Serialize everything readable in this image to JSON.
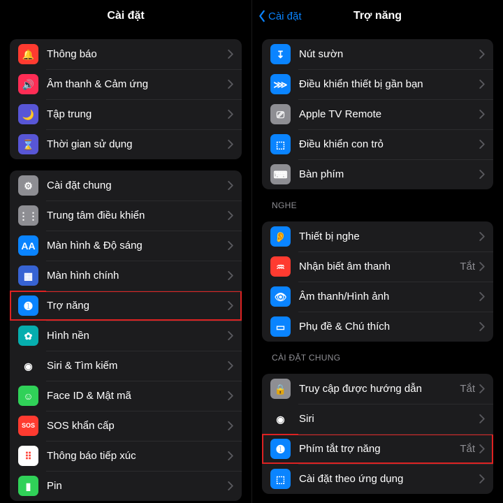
{
  "left": {
    "title": "Cài đặt",
    "groups": [
      {
        "rows": [
          {
            "key": "notifications",
            "label": "Thông báo",
            "iconBg": "#ff3b30",
            "glyph": "🔔"
          },
          {
            "key": "sounds",
            "label": "Âm thanh & Cảm ứng",
            "iconBg": "#ff2d55",
            "glyph": "🔊"
          },
          {
            "key": "focus",
            "label": "Tập trung",
            "iconBg": "#5856d6",
            "glyph": "🌙"
          },
          {
            "key": "screentime",
            "label": "Thời gian sử dụng",
            "iconBg": "#5856d6",
            "glyph": "⌛"
          }
        ]
      },
      {
        "rows": [
          {
            "key": "general",
            "label": "Cài đặt chung",
            "iconBg": "#8e8e93",
            "glyph": "⚙︎"
          },
          {
            "key": "control-center",
            "label": "Trung tâm điều khiển",
            "iconBg": "#8e8e93",
            "glyph": "⋮⋮"
          },
          {
            "key": "display",
            "label": "Màn hình & Độ sáng",
            "iconBg": "#0a84ff",
            "glyph": "AA"
          },
          {
            "key": "home-screen",
            "label": "Màn hình chính",
            "iconBg": "#3763d3",
            "glyph": "▦"
          },
          {
            "key": "accessibility",
            "label": "Trợ năng",
            "iconBg": "#0a84ff",
            "glyph": "➊",
            "highlight": true
          },
          {
            "key": "wallpaper",
            "label": "Hình nền",
            "iconBg": "#06aeae",
            "glyph": "✿"
          },
          {
            "key": "siri",
            "label": "Siri & Tìm kiếm",
            "iconBg": "#1c1c1e",
            "glyph": "◉"
          },
          {
            "key": "faceid",
            "label": "Face ID & Mật mã",
            "iconBg": "#30d158",
            "glyph": "☺︎"
          },
          {
            "key": "sos",
            "label": "SOS khẩn cấp",
            "iconBg": "#ff3b30",
            "glyph": "SOS"
          },
          {
            "key": "exposure",
            "label": "Thông báo tiếp xúc",
            "iconBg": "#ffffff",
            "glyph": "⠿",
            "glyphColor": "#ff3b30"
          },
          {
            "key": "battery",
            "label": "Pin",
            "iconBg": "#30d158",
            "glyph": "▮"
          }
        ]
      }
    ]
  },
  "right": {
    "backLabel": "Cài đặt",
    "title": "Trợ năng",
    "groups": [
      {
        "rows": [
          {
            "key": "side-button",
            "label": "Nút sườn",
            "iconBg": "#0a84ff",
            "glyph": "↧"
          },
          {
            "key": "nearby-control",
            "label": "Điều khiển thiết bị gần bạn",
            "iconBg": "#0a84ff",
            "glyph": "⋙"
          },
          {
            "key": "apple-tv-remote",
            "label": "Apple TV Remote",
            "iconBg": "#8e8e93",
            "glyph": "⎚"
          },
          {
            "key": "pointer-control",
            "label": "Điều khiển con trỏ",
            "iconBg": "#0a84ff",
            "glyph": "⬚"
          },
          {
            "key": "keyboard",
            "label": "Bàn phím",
            "iconBg": "#8e8e93",
            "glyph": "⌨︎"
          }
        ]
      },
      {
        "label": "NGHE",
        "rows": [
          {
            "key": "hearing-devices",
            "label": "Thiết bị nghe",
            "iconBg": "#0a84ff",
            "glyph": "👂"
          },
          {
            "key": "sound-recognition",
            "label": "Nhận biết âm thanh",
            "iconBg": "#ff3b30",
            "glyph": "♒︎",
            "value": "Tắt"
          },
          {
            "key": "audio-visual",
            "label": "Âm thanh/Hình ảnh",
            "iconBg": "#0a84ff",
            "glyph": "👁"
          },
          {
            "key": "subtitles",
            "label": "Phụ đề & Chú thích",
            "iconBg": "#0a84ff",
            "glyph": "▭"
          }
        ]
      },
      {
        "label": "CÀI ĐẶT CHUNG",
        "rows": [
          {
            "key": "guided-access",
            "label": "Truy cập được hướng dẫn",
            "iconBg": "#8e8e93",
            "glyph": "🔒",
            "value": "Tắt"
          },
          {
            "key": "siri",
            "label": "Siri",
            "iconBg": "#1c1c1e",
            "glyph": "◉"
          },
          {
            "key": "accessibility-shortcut",
            "label": "Phím tắt trợ năng",
            "iconBg": "#0a84ff",
            "glyph": "➊",
            "value": "Tắt",
            "highlight": true
          },
          {
            "key": "per-app-settings",
            "label": "Cài đặt theo ứng dụng",
            "iconBg": "#0a84ff",
            "glyph": "⬚"
          }
        ]
      }
    ]
  }
}
